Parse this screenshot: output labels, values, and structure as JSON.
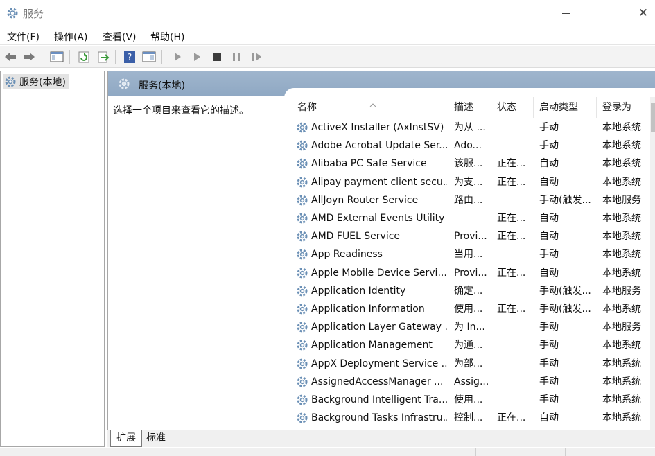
{
  "window": {
    "title": "服务",
    "controls": {
      "minimize": "minimize",
      "maximize": "maximize",
      "close": "✕"
    }
  },
  "menu": [
    "文件(F)",
    "操作(A)",
    "查看(V)",
    "帮助(H)"
  ],
  "toolbar": {
    "buttons": [
      "back-arrow-icon",
      "forward-arrow-icon",
      "show-hide-console-tree-icon",
      "refresh-icon",
      "export-list-icon",
      "help-icon",
      "properties-pane-icon",
      "start-service-icon",
      "start-service-alt-icon",
      "stop-service-icon",
      "pause-service-icon",
      "restart-service-icon"
    ]
  },
  "tree": {
    "root_label": "服务(本地)"
  },
  "right": {
    "header_title": "服务(本地)",
    "description_hint": "选择一个项目来查看它的描述。"
  },
  "columns": [
    "名称",
    "描述",
    "状态",
    "启动类型",
    "登录为"
  ],
  "services": [
    {
      "name": "ActiveX Installer (AxInstSV)",
      "desc": "为从 ...",
      "status": "",
      "startup": "手动",
      "logon": "本地系统"
    },
    {
      "name": "Adobe Acrobat Update Ser...",
      "desc": "Ado...",
      "status": "",
      "startup": "手动",
      "logon": "本地系统"
    },
    {
      "name": "Alibaba PC Safe Service",
      "desc": "该服...",
      "status": "正在...",
      "startup": "自动",
      "logon": "本地系统"
    },
    {
      "name": "Alipay payment client secu...",
      "desc": "为支...",
      "status": "正在...",
      "startup": "自动",
      "logon": "本地系统"
    },
    {
      "name": "AllJoyn Router Service",
      "desc": "路由...",
      "status": "",
      "startup": "手动(触发...",
      "logon": "本地服务"
    },
    {
      "name": "AMD External Events Utility",
      "desc": "",
      "status": "正在...",
      "startup": "自动",
      "logon": "本地系统"
    },
    {
      "name": "AMD FUEL Service",
      "desc": "Provi...",
      "status": "正在...",
      "startup": "自动",
      "logon": "本地系统"
    },
    {
      "name": "App Readiness",
      "desc": "当用...",
      "status": "",
      "startup": "手动",
      "logon": "本地系统"
    },
    {
      "name": "Apple Mobile Device Servi...",
      "desc": "Provi...",
      "status": "正在...",
      "startup": "自动",
      "logon": "本地系统"
    },
    {
      "name": "Application Identity",
      "desc": "确定...",
      "status": "",
      "startup": "手动(触发...",
      "logon": "本地服务"
    },
    {
      "name": "Application Information",
      "desc": "使用...",
      "status": "正在...",
      "startup": "手动(触发...",
      "logon": "本地系统"
    },
    {
      "name": "Application Layer Gateway ...",
      "desc": "为 In...",
      "status": "",
      "startup": "手动",
      "logon": "本地服务"
    },
    {
      "name": "Application Management",
      "desc": "为通...",
      "status": "",
      "startup": "手动",
      "logon": "本地系统"
    },
    {
      "name": "AppX Deployment Service ...",
      "desc": "为部...",
      "status": "",
      "startup": "手动",
      "logon": "本地系统"
    },
    {
      "name": "AssignedAccessManager ...",
      "desc": "Assig...",
      "status": "",
      "startup": "手动",
      "logon": "本地系统"
    },
    {
      "name": "Background Intelligent Tra...",
      "desc": "使用...",
      "status": "",
      "startup": "手动",
      "logon": "本地系统"
    },
    {
      "name": "Background Tasks Infrastru...",
      "desc": "控制...",
      "status": "正在...",
      "startup": "自动",
      "logon": "本地系统"
    }
  ],
  "bottom_tabs": [
    "扩展",
    "标准"
  ]
}
